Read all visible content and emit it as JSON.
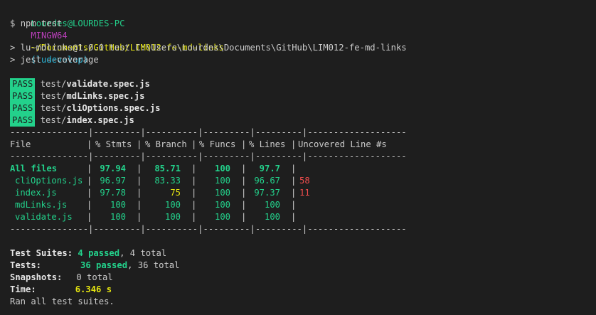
{
  "prompt": {
    "user": "Lourdes@LOURDES-PC",
    "shell": "MINGW64",
    "path": "~/Documents/GitHub/LIM012-fe-md-links",
    "branch": "(ludevelop)",
    "symbol": "$",
    "command": "npm test"
  },
  "npm_output": [
    "> lu-mdlinks@1.0.0 test C:\\Users\\Lourdes\\Documents\\GitHub\\LIM012-fe-md-links",
    "> jest --coverage"
  ],
  "test_files": [
    {
      "status": "PASS",
      "dir": "test/",
      "file": "validate.spec.js"
    },
    {
      "status": "PASS",
      "dir": "test/",
      "file": "mdLinks.spec.js"
    },
    {
      "status": "PASS",
      "dir": "test/",
      "file": "cliOptions.spec.js"
    },
    {
      "status": "PASS",
      "dir": "test/",
      "file": "index.spec.js"
    }
  ],
  "coverage": {
    "separator": "---------------|---------|----------|---------|---------|-------------------",
    "headers": [
      "File",
      "% Stmts",
      "% Branch",
      "% Funcs",
      "% Lines",
      "Uncovered Line #s"
    ],
    "rows": [
      {
        "file": "All files",
        "stmts": "97.94",
        "branch": "85.71",
        "funcs": "100",
        "lines": "97.7",
        "uncovered": "",
        "indent": false
      },
      {
        "file": "cliOptions.js",
        "stmts": "96.97",
        "branch": "83.33",
        "funcs": "100",
        "lines": "96.67",
        "uncovered": "58",
        "indent": true
      },
      {
        "file": "index.js",
        "stmts": "97.78",
        "branch": "75",
        "funcs": "100",
        "lines": "97.37",
        "uncovered": "11",
        "indent": true
      },
      {
        "file": "mdLinks.js",
        "stmts": "100",
        "branch": "100",
        "funcs": "100",
        "lines": "100",
        "uncovered": "",
        "indent": true
      },
      {
        "file": "validate.js",
        "stmts": "100",
        "branch": "100",
        "funcs": "100",
        "lines": "100",
        "uncovered": "",
        "indent": true
      }
    ]
  },
  "summary": {
    "suites_label": "Test Suites:",
    "suites_passed": "4 passed",
    "suites_total": ", 4 total",
    "tests_label": "Tests:",
    "tests_passed": "36 passed",
    "tests_total": ", 36 total",
    "snapshots_label": "Snapshots:",
    "snapshots_value": "0 total",
    "time_label": "Time:",
    "time_value": "6.346 s",
    "final": "Ran all test suites."
  },
  "colors": {
    "background": "#1e1e1e",
    "text": "#cccccc",
    "green": "#23d18b",
    "magenta": "#bc3fbc",
    "yellow": "#e5e510",
    "cyan": "#29b8db",
    "red": "#f14c4c"
  }
}
